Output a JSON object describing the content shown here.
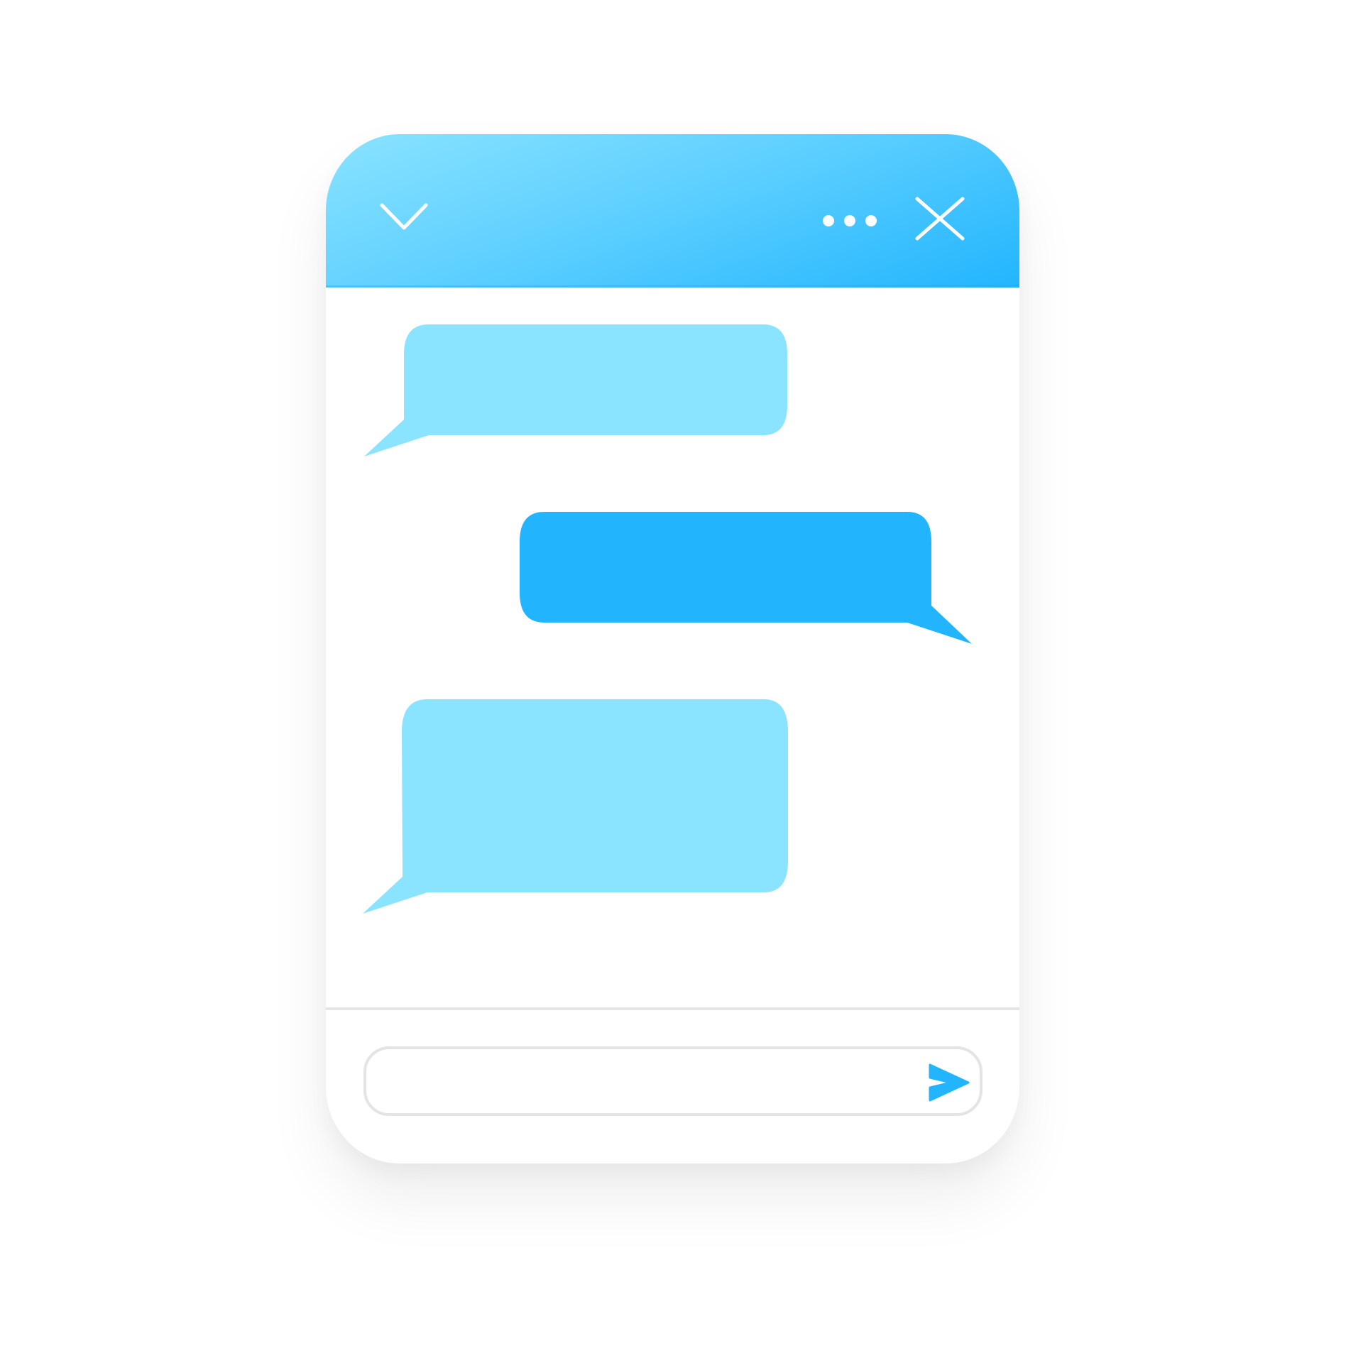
{
  "header": {
    "icons": {
      "collapse": "chevron-down-icon",
      "more": "more-options-icon",
      "close": "close-icon"
    },
    "gradient": [
      "#8ae3ff",
      "#22b5fe"
    ]
  },
  "messages": [
    {
      "direction": "incoming",
      "text": "",
      "color": "#8ae3ff"
    },
    {
      "direction": "outgoing",
      "text": "",
      "color": "#22b5fe"
    },
    {
      "direction": "incoming",
      "text": "",
      "color": "#8ae3ff"
    }
  ],
  "composer": {
    "value": "",
    "placeholder": "",
    "send_icon": "send-icon",
    "send_color": "#22b5fe",
    "border_color": "#e4e4e4"
  }
}
